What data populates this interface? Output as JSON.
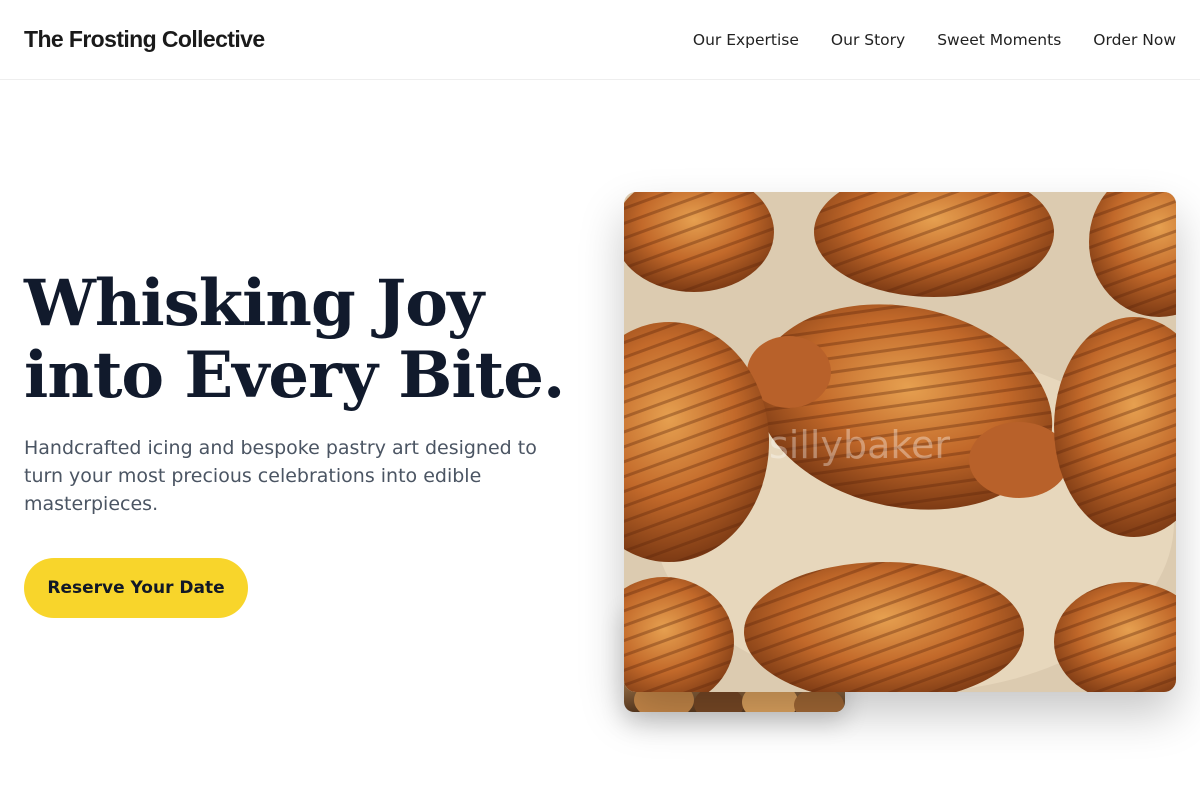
{
  "header": {
    "brand": "The Frosting Collective",
    "nav": [
      "Our Expertise",
      "Our Story",
      "Sweet Moments",
      "Order Now"
    ]
  },
  "hero": {
    "headline_line1": "Whisking Joy",
    "headline_line2": "into Every Bite.",
    "subtext": "Handcrafted icing and bespoke pastry art designed to turn your most precious celebrations into edible masterpieces.",
    "cta_label": "Reserve Your Date",
    "main_image_watermark": "sillybaker"
  },
  "colors": {
    "accent": "#f8d52b",
    "headline": "#111a2c",
    "body_text": "#4b5563"
  }
}
